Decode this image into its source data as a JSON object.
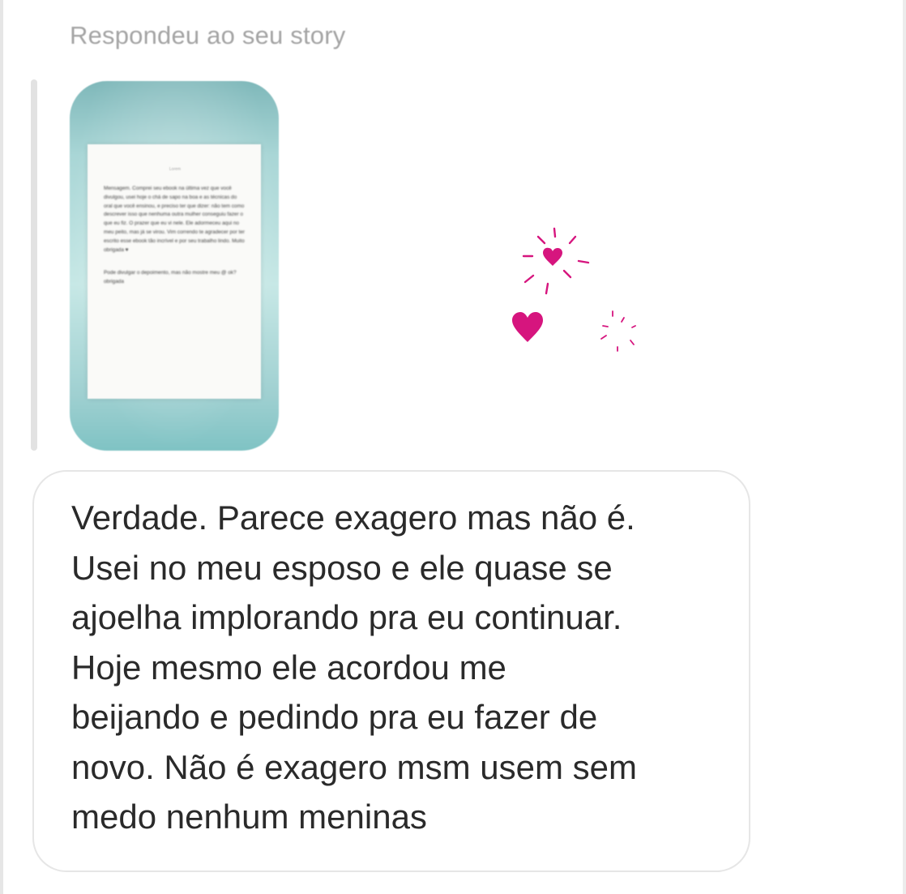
{
  "reply_header": "Respondeu ao seu story",
  "story": {
    "note_title": "Lorem",
    "note_body": "Mensagem. Comprei seu ebook na última vez que você divulgou, usei hoje o chá de sapo na boa e as técnicas do oral que você ensinou, e preciso ter que dizer: não tem como descrever isso que nenhuma outra mulher conseguiu fazer o que eu fiz. O prazer que eu vi nele. Ele adormeceu aqui no meu peito, mas já se virou. Vim correndo te agradecer por ter escrito esse ebook tão incrível e por seu trabalho lindo. Muito obrigada ♥",
    "note_footer": "Pode divulgar o depoimento, mas não mostre meu @ ok? obrigada",
    "heart_color": "#d6157e"
  },
  "message": {
    "text": "Verdade. Parece exagero mas não é.\nUsei no meu esposo e ele quase se\najoelha implorando pra eu continuar.\nHoje mesmo ele acordou me\nbeijando e pedindo pra eu fazer de\nnovo. Não é exagero msm usem sem\nmedo nenhum meninas"
  }
}
